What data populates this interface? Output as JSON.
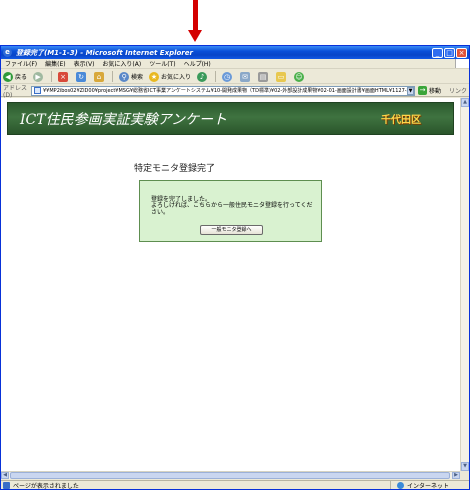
{
  "window": {
    "title": "登録完了(M1-1-3) - Microsoft Internet Explorer",
    "controls": {
      "minimize": "_",
      "maximize": "□",
      "close": "×"
    }
  },
  "menu": [
    "ファイル(F)",
    "編集(E)",
    "表示(V)",
    "お気に入り(A)",
    "ツール(T)",
    "ヘルプ(H)"
  ],
  "toolbar": {
    "back_label": "戻る",
    "search_label": "検索",
    "favorites_label": "お気に入り"
  },
  "address": {
    "label": "アドレス(D)",
    "url": "¥¥MP2ibos02¥ZID00¥project¥MSG¥総務省ICT事業アンケートシステム¥10-開発成果物（TD標準)¥02-外部設計成果物¥02-01-画面設計書¥画面HTML¥1127-2¥HTML¥M1127-2¥HTM",
    "go_label": "移動",
    "links_label": "リンク"
  },
  "page": {
    "banner_title": "ICT住民参画実証実験アンケート",
    "organization": "千代田区",
    "heading": "特定モニタ登録完了",
    "message_line1": "登録を完了しました。",
    "message_line2": "よろしければ、こちらから一般住民モニタ登録を行ってください。",
    "button_label": "一般モニタ登録へ"
  },
  "status": {
    "text": "ページが表示されました",
    "zone": "インターネット"
  },
  "colors": {
    "accent_arrow": "#d40000",
    "banner_green": "#3f7340",
    "org_text": "#ffd54a",
    "message_bg": "#d9f2d0"
  }
}
